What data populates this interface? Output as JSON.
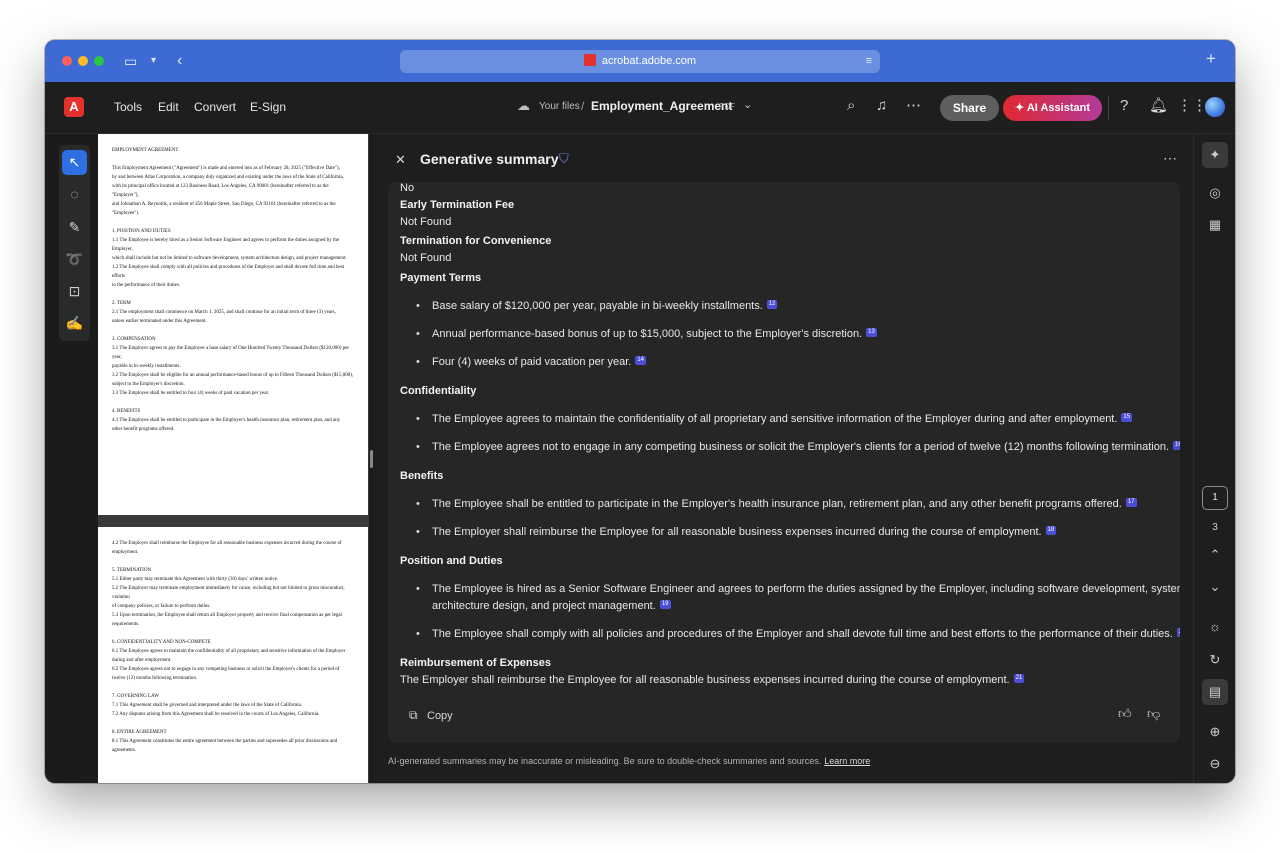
{
  "browser": {
    "url": "acrobat.adobe.com",
    "sidebar_icon": "sidebar-toggle-icon",
    "back_icon": "chevron-left-icon",
    "new_tab": "+"
  },
  "appbar": {
    "menu": [
      "Tools",
      "Edit",
      "Convert",
      "E-Sign"
    ],
    "breadcrumb_root": "Your files",
    "separator": "/",
    "doc_name": "Employment_Agreement",
    "doc_type": "PDF",
    "share_label": "Share",
    "ai_label": "AI Assistant"
  },
  "document": {
    "page1": [
      "EMPLOYMENT AGREEMENT",
      "",
      "This Employment Agreement (\"Agreement\") is made and entered into as of February 28, 2025 (\"Effective Date\"),",
      "by and between Atlas Corporation, a company duly organized and existing under the laws of the State of California,",
      "with its principal office located at 123 Business Road, Los Angeles, CA 90001 (hereinafter referred to as the \"Employer\"),",
      "and Johnathan A. Reynolds, a resident of 456 Maple Street, San Diego, CA 92101 (hereinafter referred to as the \"Employee\").",
      "",
      "1. POSITION AND DUTIES",
      "1.1 The Employee is hereby hired as a Senior Software Engineer and agrees to perform the duties assigned by the Employer,",
      "which shall include but not be limited to software development, system architecture design, and project management.",
      "1.2 The Employee shall comply with all policies and procedures of the Employer and shall devote full time and best efforts",
      "to the performance of their duties.",
      "",
      "2. TERM",
      "2.1 The employment shall commence on March 1, 2025, and shall continue for an initial term of three (3) years,",
      "unless earlier terminated under this Agreement.",
      "",
      "3. COMPENSATION",
      "3.1 The Employer agrees to pay the Employee a base salary of One Hundred Twenty Thousand Dollars ($120,000) per year,",
      "payable in bi-weekly installments.",
      "3.2 The Employee shall be eligible for an annual performance-based bonus of up to Fifteen Thousand Dollars ($15,000),",
      "subject to the Employer's discretion.",
      "3.3 The Employee shall be entitled to four (4) weeks of paid vacation per year.",
      "",
      "4. BENEFITS",
      "4.1 The Employee shall be entitled to participate in the Employer's health insurance plan, retirement plan, and any",
      "other benefit programs offered."
    ],
    "page2": [
      "4.2 The Employer shall reimburse the Employee for all reasonable business expenses incurred during the course of employment.",
      "",
      "5. TERMINATION",
      "5.1 Either party may terminate this Agreement with thirty (30) days' written notice.",
      "5.2 The Employer may terminate employment immediately for cause, including but not limited to gross misconduct, violation",
      "of company policies, or failure to perform duties.",
      "5.3 Upon termination, the Employee shall return all Employer property and receive final compensation as per legal requirements.",
      "",
      "6. CONFIDENTIALITY AND NON-COMPETE",
      "6.1 The Employee agrees to maintain the confidentiality of all proprietary and sensitive information of the Employer",
      "during and after employment.",
      "6.2 The Employee agrees not to engage in any competing business or solicit the Employer's clients for a period of",
      "twelve (12) months following termination.",
      "",
      "7. GOVERNING LAW",
      "7.1 This Agreement shall be governed and interpreted under the laws of the State of California.",
      "7.2 Any disputes arising from this Agreement shall be resolved in the courts of Los Angeles, California.",
      "",
      "8. ENTIRE AGREEMENT",
      "8.1 This Agreement constitutes the entire agreement between the parties and supersedes all prior discussions and agreements."
    ]
  },
  "summary": {
    "title": "Generative summary",
    "lines": {
      "no": "No",
      "early_fee_h": "Early Termination Fee",
      "early_fee_v": "Not Found",
      "conv_h": "Termination for Convenience",
      "conv_v": "Not Found",
      "payment_h": "Payment Terms",
      "payment_1": "Base salary of $120,000 per year, payable in bi-weekly installments.",
      "payment_1_cite": "12",
      "payment_2": "Annual performance-based bonus of up to $15,000, subject to the Employer's discretion.",
      "payment_2_cite": "13",
      "payment_3": "Four (4) weeks of paid vacation per year.",
      "payment_3_cite": "14",
      "conf_h": "Confidentiality",
      "conf_1": "The Employee agrees to maintain the confidentiality of all proprietary and sensitive information of the Employer during and after employment.",
      "conf_1_cite": "15",
      "conf_2": "The Employee agrees not to engage in any competing business or solicit the Employer's clients for a period of twelve (12) months following termination.",
      "conf_2_cite": "16",
      "ben_h": "Benefits",
      "ben_1": "The Employee shall be entitled to participate in the Employer's health insurance plan, retirement plan, and any other benefit programs offered.",
      "ben_1_cite": "17",
      "ben_2": "The Employer shall reimburse the Employee for all reasonable business expenses incurred during the course of employment.",
      "ben_2_cite": "18",
      "pos_h": "Position and Duties",
      "pos_1a": "The Employee is hired as a Senior Software Engineer and agrees to perform the duties assigned by the Employer, including software development, system",
      "pos_1b": "architecture design, and project management.",
      "pos_1_cite": "19",
      "pos_2": "The Employee shall comply with all policies and procedures of the Employer and shall devote full time and best efforts to the performance of their duties.",
      "pos_2_cite": "20",
      "reimb_h": "Reimbursement of Expenses",
      "reimb_v": "The Employer shall reimburse the Employee for all reasonable business expenses incurred during the course of employment.",
      "reimb_cite": "21"
    },
    "copy_label": "Copy",
    "disclaimer": "AI-generated summaries may be inaccurate or misleading. Be sure to double-check summaries and sources.",
    "learn_more": "Learn more"
  },
  "pagination": {
    "current": "1",
    "total": "3"
  },
  "colors": {
    "chrome": "#3e6bd3",
    "accent": "#2f6fe4",
    "citation": "#4b4fd6",
    "ai_gradient_start": "#e0292f",
    "ai_gradient_end": "#b23a9b"
  }
}
